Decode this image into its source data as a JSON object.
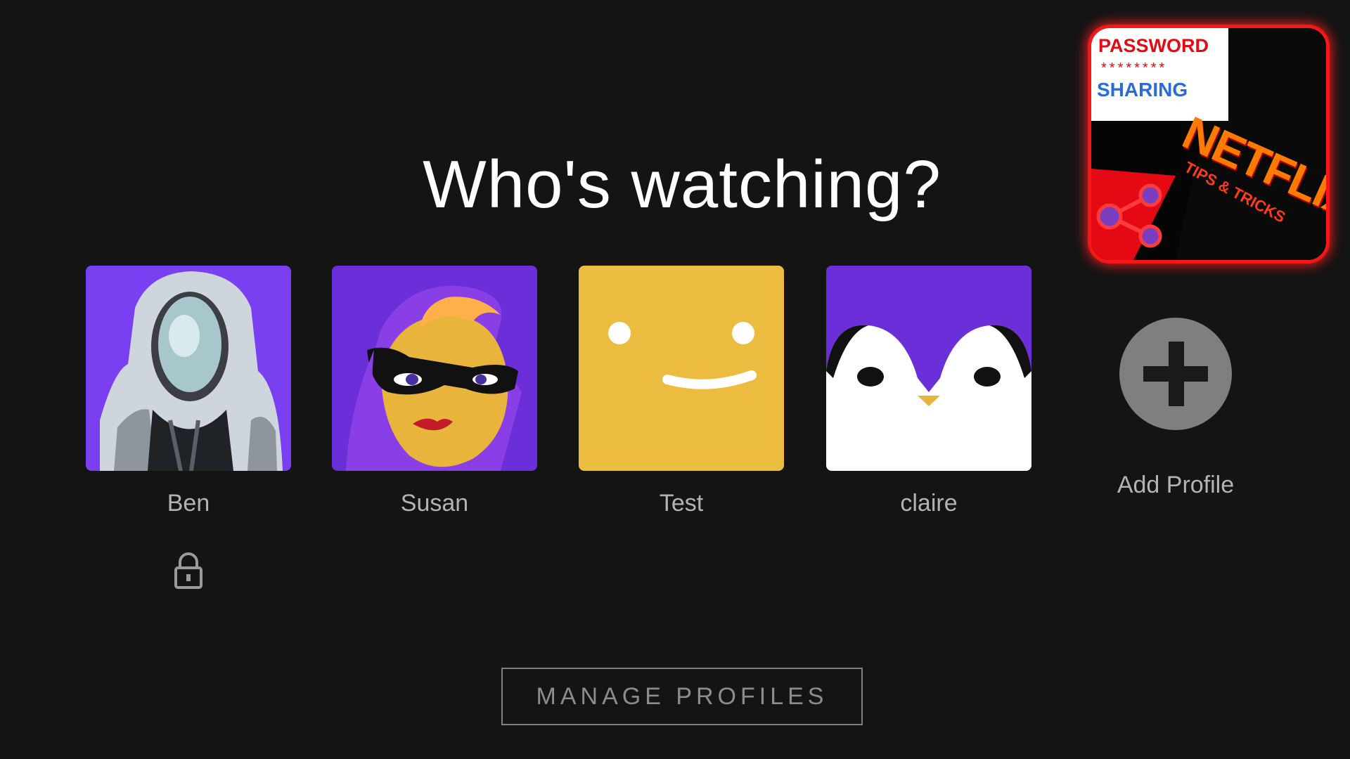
{
  "heading": "Who's watching?",
  "profiles": [
    {
      "name": "Ben",
      "locked": true,
      "avatar_icon": "robot-helmet-avatar",
      "bg": "#7a3ff0"
    },
    {
      "name": "Susan",
      "locked": false,
      "avatar_icon": "masked-hero-avatar",
      "bg": "#6a2fd8"
    },
    {
      "name": "Test",
      "locked": false,
      "avatar_icon": "yellow-smiley-avatar",
      "bg": "#ebbc40"
    },
    {
      "name": "claire",
      "locked": false,
      "avatar_icon": "penguin-avatar",
      "bg": "#6a2fd8"
    }
  ],
  "add_profile": {
    "label": "Add Profile",
    "icon": "plus-icon"
  },
  "manage_button": "MANAGE PROFILES",
  "thumbnail": {
    "line1": "PASSWORD",
    "dots": "********",
    "line2": "SHARING",
    "brand": "NETFLIX",
    "subtitle": "TIPS & TRICKS",
    "icon": "share-icon"
  },
  "colors": {
    "background": "#141414",
    "title": "#ffffff",
    "label": "#b3b3b3",
    "accent_red": "#e50914"
  }
}
